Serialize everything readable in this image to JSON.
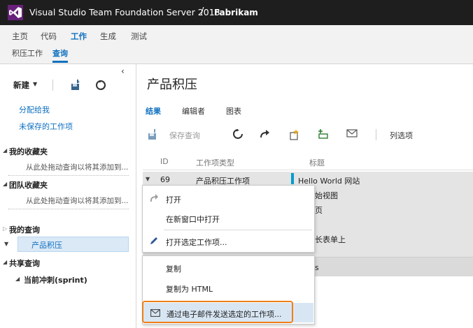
{
  "titlebar": {
    "app_title": "Visual Studio Team Foundation Server 2013",
    "separator": "/",
    "project": "Fabrikam",
    "logo_color": "#68217a"
  },
  "hub_nav": {
    "items": [
      {
        "label": "主页",
        "active": false
      },
      {
        "label": "代码",
        "active": false
      },
      {
        "label": "工作",
        "active": true
      },
      {
        "label": "生成",
        "active": false
      },
      {
        "label": "测试",
        "active": false
      }
    ]
  },
  "sub_nav": {
    "items": [
      {
        "label": "积压工作",
        "active": false
      },
      {
        "label": "查询",
        "active": true
      }
    ]
  },
  "left_pane": {
    "collapse_glyph": "‹",
    "new_label": "新建",
    "new_caret": "▼",
    "links": [
      "分配给我",
      "未保存的工作项"
    ],
    "favorites_mine": {
      "title": "我的收藏夹",
      "hint": "从此处拖动查询以将其添加到..."
    },
    "favorites_team": {
      "title": "团队收藏夹",
      "hint": "从此处拖动查询以将其添加到..."
    },
    "my_queries": {
      "title": "我的查询",
      "selected_query": "产品积压"
    },
    "shared_queries": {
      "title": "共享查询",
      "child": "当前冲刺(sprint)"
    }
  },
  "main": {
    "page_title": "产品积压",
    "tabs": [
      {
        "label": "结果",
        "active": true
      },
      {
        "label": "编辑者",
        "active": false
      },
      {
        "label": "图表",
        "active": false
      }
    ],
    "toolbar": {
      "save_query_label": "保存查询",
      "column_options_label": "列选项"
    },
    "grid": {
      "columns": [
        "ID",
        "工作项类型",
        "标题"
      ],
      "rows": [
        {
          "id": "69",
          "type": "产品积压工作项",
          "title": "Hello World 网站"
        }
      ],
      "peek_fragments": [
        "始视图",
        "页",
        "长表单上",
        "s"
      ],
      "accent_color": "#009ccc"
    }
  },
  "context_menu": {
    "group1": [
      "打开",
      "在新窗口中打开",
      "打开选定工作项..."
    ],
    "group2": [
      "复制",
      "复制为 HTML",
      "通过电子邮件发送选定的工作项..."
    ],
    "highlight_color": "#f07f16"
  }
}
